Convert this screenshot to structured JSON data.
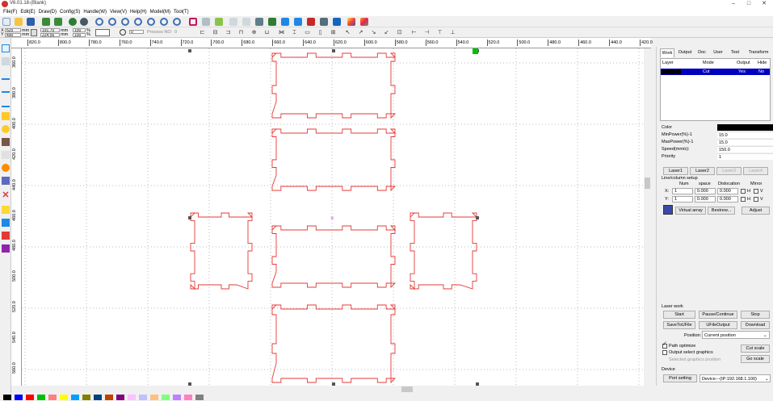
{
  "app": {
    "title": "V6.01.18-(Blank)"
  },
  "window_controls": {
    "minimize": "–",
    "maximize": "□",
    "close": "✕"
  },
  "menu": [
    "File(F)",
    "Edit(E)",
    "Draw(D)",
    "Config(S)",
    "Handle(W)",
    "View(V)",
    "Help(H)",
    "Model(M)",
    "Tool(T)"
  ],
  "coords": {
    "x_label": "X",
    "x": "625",
    "x_unit": "mm",
    "y_label": "Y",
    "y": "490",
    "y_unit": "mm",
    "w": "191.70",
    "w_unit": "mm",
    "h": "224.56",
    "h_unit": "mm",
    "sx": "100",
    "sy": "100",
    "pct": "%",
    "rot_value": "0",
    "process_no_label": "Process NO:",
    "process_no": "0"
  },
  "ruler_top": [
    "820.0",
    "800.0",
    "780.0",
    "760.0",
    "740.0",
    "720.0",
    "700.0",
    "680.0",
    "660.0",
    "640.0",
    "620.0",
    "600.0",
    "580.0",
    "560.0",
    "540.0",
    "520.0",
    "500.0",
    "480.0",
    "460.0",
    "440.0",
    "420.0"
  ],
  "ruler_left": [
    "360.0",
    "380.0",
    "400.0",
    "420.0",
    "440.0",
    "460.0",
    "480.0",
    "500.0",
    "520.0",
    "540.0",
    "560.0"
  ],
  "panel": {
    "tabs": [
      "Work",
      "Output",
      "Doc",
      "User",
      "Test",
      "Transform"
    ],
    "layer_headers": [
      "Layer",
      "Mode",
      "Output",
      "Hide"
    ],
    "layer_row": {
      "color": "#000000",
      "mode": "Cut",
      "output": "Yes",
      "hide": "No"
    },
    "props": [
      {
        "label": "Color",
        "value": ""
      },
      {
        "label": "MinPower(%)-1",
        "value": "15.0"
      },
      {
        "label": "MaxPower(%)-1",
        "value": "15.0"
      },
      {
        "label": "Speed(mm/s):",
        "value": "150.0"
      },
      {
        "label": "Priority",
        "value": "1"
      }
    ],
    "laser_tabs": [
      "Laser1",
      "Laser2",
      "Laser3",
      "Laser4"
    ],
    "line_col_title": "Line/column setup",
    "lc_headers": [
      "Num",
      "space",
      "Dislocation",
      "Mirror"
    ],
    "lc_rows": [
      {
        "axis": "X:",
        "num": "1",
        "space": "0.000",
        "dis": "0.000",
        "mirror_h": "H",
        "mirror_v": "V"
      },
      {
        "axis": "Y:",
        "num": "1",
        "space": "0.000",
        "dis": "0.000",
        "mirror_h": "H",
        "mirror_v": "V"
      }
    ],
    "virtual_array": "Virtual array",
    "bestrew": "Bestrew...",
    "adjust": "Adjust",
    "laser_work_title": "Laser work",
    "start": "Start",
    "pause": "Pause/Continue",
    "stop": "Stop",
    "save_to_file": "SaveToUFile",
    "ufile_output": "UFileOutput",
    "download": "Download",
    "position_label": "Position:",
    "position_value": "Current position",
    "path_optimize": "Path optimize",
    "output_select": "Output select graphics",
    "selected_pos": "Selected graphics position",
    "cut_scale": "Cut scale",
    "go_scale": "Go scale",
    "device_title": "Device",
    "port_setting": "Port setting",
    "device_value": "Device---(IP:192.168.1.100)"
  },
  "colors": {
    "shape_stroke": "#e53935",
    "accent_blue": "#0000c0",
    "palette": [
      "#000000",
      "#0000ff",
      "#ff0000",
      "#00c000",
      "#ff8080",
      "#ffff00",
      "#00a0ff",
      "#808000",
      "#004080",
      "#c04000",
      "#800080",
      "#ffc0ff",
      "#c0c0ff",
      "#ffc080",
      "#80ff80",
      "#c080ff",
      "#ff80c0",
      "#808080"
    ]
  }
}
